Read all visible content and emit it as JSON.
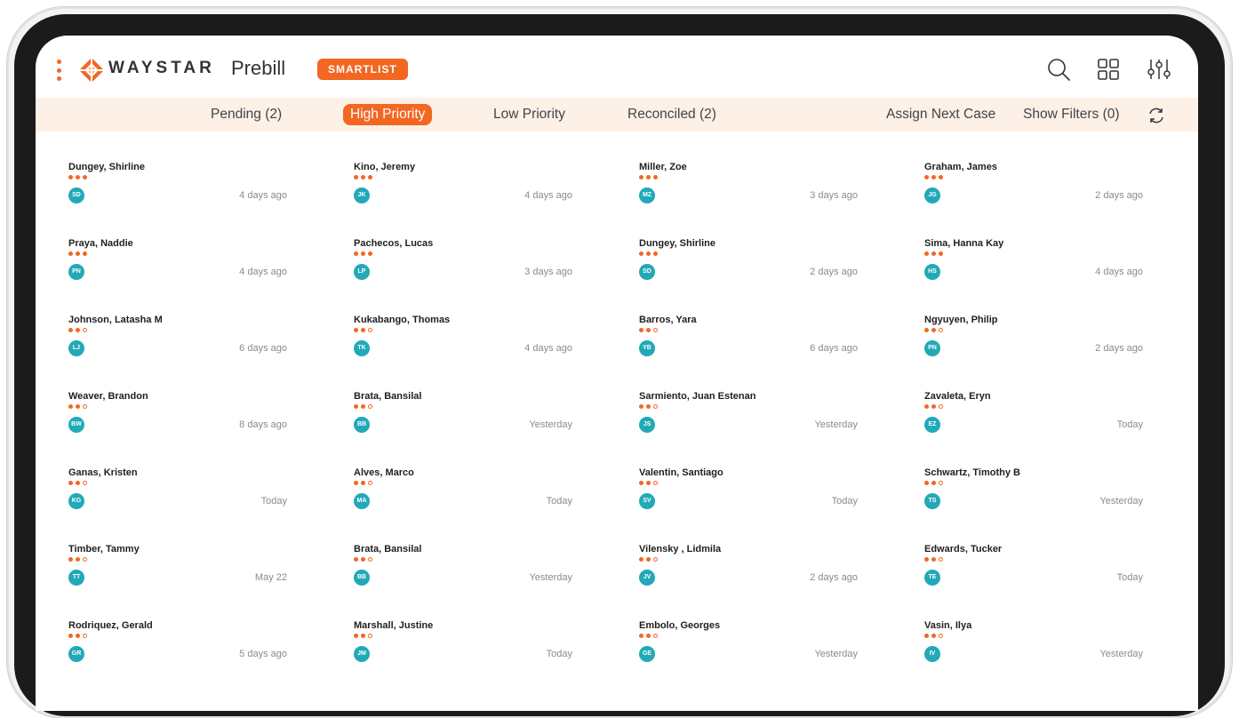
{
  "app": {
    "brand": "WAYSTAR",
    "product": "Prebill",
    "badge": "SMARTLIST",
    "brand_color": "#f26722",
    "avatar_color": "#22a9b8"
  },
  "header_icons": [
    "search-icon",
    "grid-view-icon",
    "filter-sliders-icon"
  ],
  "tabs": [
    {
      "label": "Pending (2)",
      "active": false
    },
    {
      "label": "High Priority",
      "active": true
    },
    {
      "label": "Low Priority",
      "active": false
    },
    {
      "label": "Reconciled (2)",
      "active": false
    }
  ],
  "actions": {
    "assign_next": "Assign Next Case",
    "show_filters": "Show Filters (0)"
  },
  "cards": [
    [
      {
        "name": "Dungey, Shirline",
        "initials": "SD",
        "time": "4 days ago",
        "priority": 3
      },
      {
        "name": "Praya, Naddie",
        "initials": "PN",
        "time": "4 days ago",
        "priority": 3
      },
      {
        "name": "Johnson, Latasha M",
        "initials": "LJ",
        "time": "6 days ago",
        "priority": 2
      },
      {
        "name": "Weaver, Brandon",
        "initials": "BW",
        "time": "8 days ago",
        "priority": 2
      },
      {
        "name": "Ganas, Kristen",
        "initials": "KG",
        "time": "Today",
        "priority": 2
      },
      {
        "name": "Timber, Tammy",
        "initials": "TT",
        "time": "May 22",
        "priority": 2
      },
      {
        "name": "Rodriquez, Gerald",
        "initials": "GR",
        "time": "5 days ago",
        "priority": 2
      }
    ],
    [
      {
        "name": "Kino, Jeremy",
        "initials": "JK",
        "time": "4 days ago",
        "priority": 3
      },
      {
        "name": "Pachecos, Lucas",
        "initials": "LP",
        "time": "3 days ago",
        "priority": 3
      },
      {
        "name": "Kukabango, Thomas",
        "initials": "TK",
        "time": "4 days ago",
        "priority": 2
      },
      {
        "name": "Brata, Bansilal",
        "initials": "BB",
        "time": "Yesterday",
        "priority": 2
      },
      {
        "name": "Alves, Marco",
        "initials": "MA",
        "time": "Today",
        "priority": 2
      },
      {
        "name": "Brata, Bansilal",
        "initials": "BB",
        "time": "Yesterday",
        "priority": 2
      },
      {
        "name": "Marshall, Justine",
        "initials": "JM",
        "time": "Today",
        "priority": 2
      }
    ],
    [
      {
        "name": "Miller, Zoe",
        "initials": "MZ",
        "time": "3 days ago",
        "priority": 3
      },
      {
        "name": "Dungey, Shirline",
        "initials": "SD",
        "time": "2 days ago",
        "priority": 3
      },
      {
        "name": "Barros, Yara",
        "initials": "YB",
        "time": "6 days ago",
        "priority": 2
      },
      {
        "name": "Sarmiento, Juan Estenan",
        "initials": "JS",
        "time": "Yesterday",
        "priority": 2
      },
      {
        "name": "Valentin, Santiago",
        "initials": "SV",
        "time": "Today",
        "priority": 2
      },
      {
        "name": "Vilensky , Lidmila",
        "initials": "JV",
        "time": "2 days ago",
        "priority": 2
      },
      {
        "name": "Embolo, Georges",
        "initials": "GE",
        "time": "Yesterday",
        "priority": 2
      }
    ],
    [
      {
        "name": "Graham, James",
        "initials": "JG",
        "time": "2 days ago",
        "priority": 3
      },
      {
        "name": "Sima, Hanna Kay",
        "initials": "HS",
        "time": "4 days ago",
        "priority": 3
      },
      {
        "name": "Ngyuyen, Philip",
        "initials": "PN",
        "time": "2 days ago",
        "priority": 2
      },
      {
        "name": "Zavaleta, Eryn",
        "initials": "EZ",
        "time": "Today",
        "priority": 2
      },
      {
        "name": "Schwartz, Timothy B",
        "initials": "TS",
        "time": "Yesterday",
        "priority": 2
      },
      {
        "name": "Edwards, Tucker",
        "initials": "TE",
        "time": "Today",
        "priority": 2
      },
      {
        "name": "Vasin, Ilya",
        "initials": "IV",
        "time": "Yesterday",
        "priority": 2
      }
    ]
  ]
}
